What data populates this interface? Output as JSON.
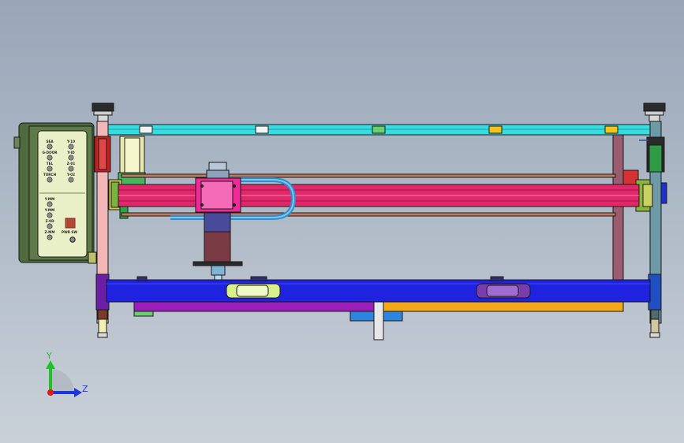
{
  "viewport": {
    "background_top": "#98a6b8",
    "background_bottom": "#c9d0d8"
  },
  "triad": {
    "y_label": "Y",
    "z_label": "Z",
    "y_color": "#22c12a",
    "z_color": "#1e35d8",
    "origin_color": "#e01818"
  },
  "control_panel": {
    "upper_labels": [
      "SEA",
      "Y-10",
      "G-DOOR",
      "Y-ID",
      "TEL",
      "Z-01",
      "TORCH",
      "Y-02"
    ],
    "lower_labels": [
      "Y-MM",
      "Y-MM",
      "Z-0D",
      "Z-MM"
    ],
    "note_label": "PWR SW"
  },
  "colors": {
    "top_rail": "#35dde2",
    "gantry_beam": "#e0286a",
    "carriage": "#f02a9a",
    "cable_loop": "#2d8fd0",
    "base_beam": "#1f23e0",
    "lower_rail_left": "#9a1fb6",
    "lower_rail_right": "#f2a81a",
    "panel_frame": "#4f6b3e",
    "panel_face": "#e9f0c7",
    "left_post": "#f2b6b6",
    "right_post": "#6d9aa6"
  }
}
